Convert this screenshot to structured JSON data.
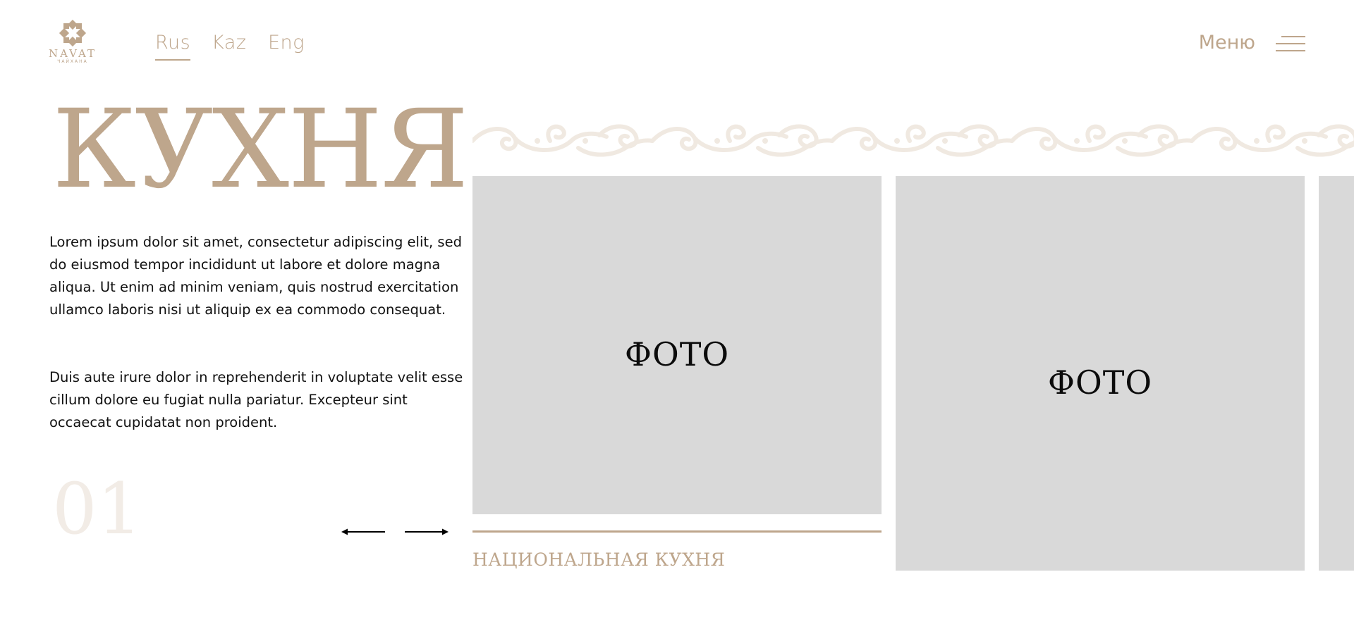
{
  "brand": {
    "name": "NAVAT",
    "subtitle": "ЧАЙХАНА"
  },
  "languages": [
    {
      "label": "Rus",
      "active": true
    },
    {
      "label": "Kaz",
      "active": false
    },
    {
      "label": "Eng",
      "active": false
    }
  ],
  "menu": {
    "label": "Меню"
  },
  "hero": {
    "title": "КУХНЯ",
    "paragraphs": [
      "Lorem ipsum dolor sit amet, consectetur adipiscing elit, sed do eiusmod tempor incididunt ut labore et dolore magna aliqua. Ut enim ad minim veniam, quis nostrud exercitation ullamco laboris nisi ut aliquip ex ea commodo consequat.",
      "Duis aute irure dolor in reprehenderit in voluptate velit esse cillum dolore eu fugiat nulla pariatur. Excepteur sint occaecat cupidatat non proident."
    ],
    "slide_number": "01"
  },
  "slider": {
    "prev_icon": "arrow-left-icon",
    "next_icon": "arrow-right-icon",
    "cards": [
      {
        "label": "ФОТО",
        "caption": "НАЦИОНАЛЬНАЯ КУХНЯ"
      },
      {
        "label": "ФОТО"
      }
    ]
  },
  "colors": {
    "accent": "#bea68c",
    "placeholder": "#d9d9d9",
    "ornament": "#f3ede6",
    "slide_number": "#f2ece6"
  }
}
